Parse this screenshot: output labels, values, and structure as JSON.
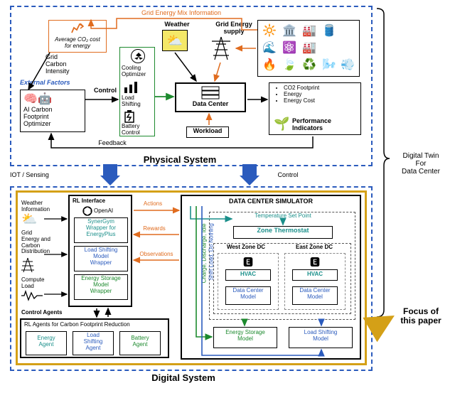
{
  "outer_right": {
    "digital_twin_line1": "Digital Twin",
    "digital_twin_line2": "For",
    "digital_twin_line3": "Data Center",
    "focus_line1": "Focus of",
    "focus_line2": "this paper"
  },
  "between": {
    "iot_sensing": "IOT / Sensing",
    "control": "Control"
  },
  "physical": {
    "title": "Physical System",
    "grid_mix_info": "Grid Energy Mix Information",
    "weather": "Weather",
    "grid_supply": "Grid Energy supply",
    "avg_co2_line1": "Average CO₂ cost",
    "avg_co2_line2": "for energy",
    "grid_ci_line1": "Grid",
    "grid_ci_line2": "Carbon",
    "grid_ci_line3": "Intensity",
    "external_factors": "External Factors",
    "ai_opt_line1": "AI Carbon",
    "ai_opt_line2": "Footprint",
    "ai_opt_line3": "Optimizer",
    "control_lbl": "Control",
    "cooling_line1": "Cooling",
    "cooling_line2": "Optimizer",
    "load_shift_line1": "Load",
    "load_shift_line2": "Shifting",
    "battery_line1": "Battery",
    "battery_line2": "Control",
    "data_center": "Data Center",
    "workload": "Workload",
    "feedback": "Feedback",
    "pi_co2": "CO2 Footprint",
    "pi_energy": "Energy",
    "pi_cost": "Energy Cost",
    "pi_title_line1": "Performance",
    "pi_title_line2": "Indicators"
  },
  "digital": {
    "title": "Digital System",
    "rl_interface": "RL Interface",
    "openai": "OpenAI",
    "weather_line1": "Weather",
    "weather_line2": "Information",
    "grid_line1": "Grid",
    "grid_line2": "Energy and",
    "grid_line3": "Carbon",
    "grid_line4": "Distribution",
    "compute_line1": "Compute",
    "compute_line2": "Load",
    "synergym_line1": "SynerGym",
    "synergym_line2": "Wrapper for",
    "synergym_line3": "EnergyPlus",
    "lsw_line1": "Load Shifting",
    "lsw_line2": "Model",
    "lsw_line3": "Wrapper",
    "esw_line1": "Energy Storage",
    "esw_line2": "Model",
    "esw_line3": "Wrapper",
    "actions": "Actions",
    "rewards": "Rewards",
    "observations": "Observations",
    "control_agents": "Control Agents",
    "rl_agents": "RL Agents for Carbon Footprint Reduction",
    "energy_agent_line1": "Energy",
    "energy_agent_line2": "Agent",
    "ls_agent_line1": "Load",
    "ls_agent_line2": "Shifting",
    "ls_agent_line3": "Agent",
    "bat_agent_line1": "Battery",
    "bat_agent_line2": "Agent",
    "simulator": "DATA CENTER SIMULATOR",
    "shift_load": "Shift Load, Do Nothing",
    "charge": "Charge, Discharge, Idle",
    "temp_setpoint": "Temperature Set Point",
    "zone_thermostat": "Zone Thermostat",
    "west_zone": "West Zone DC",
    "east_zone": "East Zone DC",
    "hvac": "HVAC",
    "dc_model_line1": "Data Center",
    "dc_model_line2": "Model",
    "es_model_line1": "Energy Storage",
    "es_model_line2": "Model",
    "ls_model_line1": "Load Shifting",
    "ls_model_line2": "Model"
  }
}
